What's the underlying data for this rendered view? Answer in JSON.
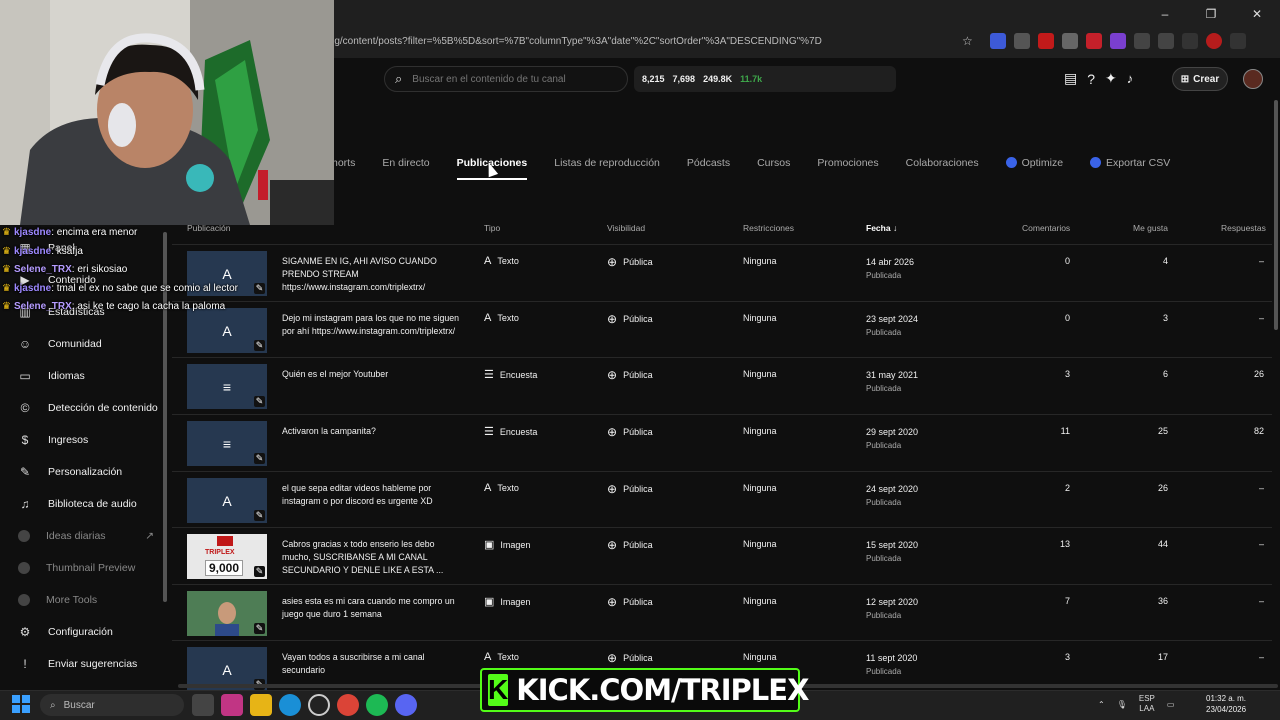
{
  "browser": {
    "url": "Mg/content/posts?filter=%5B%5D&sort=%7B\"columnType\"%3A\"date\"%2C\"sortOrder\"%3A\"DESCENDING\"%7D"
  },
  "header": {
    "search_placeholder": "Buscar en el contenido de tu canal",
    "stats": {
      "a": "8,215",
      "b": "7,698",
      "c": "249.8K",
      "d": "11.7k"
    },
    "create_label": "Crear"
  },
  "tabs": [
    {
      "label": "horts"
    },
    {
      "label": "En directo"
    },
    {
      "label": "Publicaciones"
    },
    {
      "label": "Listas de reproducción"
    },
    {
      "label": "Pódcasts"
    },
    {
      "label": "Cursos"
    },
    {
      "label": "Promociones"
    },
    {
      "label": "Colaboraciones"
    },
    {
      "label": "Optimize"
    },
    {
      "label": "Exportar CSV"
    }
  ],
  "sidebar": {
    "items": [
      {
        "label": "Panel"
      },
      {
        "label": "Contenido"
      },
      {
        "label": "Estadísticas"
      },
      {
        "label": "Comunidad"
      },
      {
        "label": "Idiomas"
      },
      {
        "label": "Detección de contenido"
      },
      {
        "label": "Ingresos"
      },
      {
        "label": "Personalización"
      },
      {
        "label": "Biblioteca de audio"
      },
      {
        "label": "Ideas diarias"
      },
      {
        "label": "Thumbnail Preview"
      },
      {
        "label": "More Tools"
      },
      {
        "label": "Configuración"
      },
      {
        "label": "Enviar sugerencias"
      }
    ]
  },
  "table": {
    "headers": {
      "post": "Publicación",
      "type": "Tipo",
      "visibility": "Visibilidad",
      "restrictions": "Restricciones",
      "date": "Fecha",
      "comments": "Comentarios",
      "likes": "Me gusta",
      "replies": "Respuestas"
    },
    "rows": [
      {
        "thumb": "A",
        "text": "SIGANME EN IG, AHI AVISO CUANDO PRENDO STREAM https://www.instagram.com/triplextrx/",
        "type": "Texto",
        "visibility": "Pública",
        "restrictions": "Ninguna",
        "date": "14 abr 2026",
        "status": "Publicada",
        "comments": "0",
        "likes": "4",
        "replies": "–"
      },
      {
        "thumb": "A",
        "text": "Dejo mi instagram para los que no me siguen por ahí https://www.instagram.com/triplextrx/",
        "type": "Texto",
        "visibility": "Pública",
        "restrictions": "Ninguna",
        "date": "23 sept 2024",
        "status": "Publicada",
        "comments": "0",
        "likes": "3",
        "replies": "–"
      },
      {
        "thumb": "≡",
        "text": "Quién es el mejor Youtuber",
        "type": "Encuesta",
        "visibility": "Pública",
        "restrictions": "Ninguna",
        "date": "31 may 2021",
        "status": "Publicada",
        "comments": "3",
        "likes": "6",
        "replies": "26"
      },
      {
        "thumb": "≡",
        "text": "Activaron la campanita?",
        "type": "Encuesta",
        "visibility": "Pública",
        "restrictions": "Ninguna",
        "date": "29 sept 2020",
        "status": "Publicada",
        "comments": "11",
        "likes": "25",
        "replies": "82"
      },
      {
        "thumb": "A",
        "text": "el que sepa editar videos hableme por instagram o por discord es urgente XD",
        "type": "Texto",
        "visibility": "Pública",
        "restrictions": "Ninguna",
        "date": "24 sept 2020",
        "status": "Publicada",
        "comments": "2",
        "likes": "26",
        "replies": "–"
      },
      {
        "thumb": "9,000",
        "text": "Cabros gracias x todo enserio les debo mucho, SUSCRIBANSE A MI CANAL SECUNDARIO Y DENLE LIKE A ESTA ...",
        "type": "Imagen",
        "visibility": "Pública",
        "restrictions": "Ninguna",
        "date": "15 sept 2020",
        "status": "Publicada",
        "comments": "13",
        "likes": "44",
        "replies": "–"
      },
      {
        "thumb": "",
        "text": "asies esta es mi cara cuando me compro un juego que duro 1 semana",
        "type": "Imagen",
        "visibility": "Pública",
        "restrictions": "Ninguna",
        "date": "12 sept 2020",
        "status": "Publicada",
        "comments": "7",
        "likes": "36",
        "replies": "–"
      },
      {
        "thumb": "A",
        "text": "Vayan todos a suscribirse a mi canal secundario",
        "type": "Texto",
        "visibility": "Pública",
        "restrictions": "Ninguna",
        "date": "11 sept 2020",
        "status": "Publicada",
        "comments": "3",
        "likes": "17",
        "replies": "–"
      }
    ]
  },
  "chat": [
    {
      "user": "kjasdne",
      "msg": "encima era menor"
    },
    {
      "user": "kjasdne",
      "msg": "ksafja"
    },
    {
      "user": "Selene_TRX",
      "msg": "eri sikosiao"
    },
    {
      "user": "kjasdne",
      "msg": "tmal el ex no sabe que se comio al lector"
    },
    {
      "user": "Selene_TRX",
      "msg": "asi ke te cago la cacha la paloma"
    }
  ],
  "taskbar": {
    "search": "Buscar",
    "lang": "ESP",
    "lang2": "LAA",
    "time": "01:32 a. m.",
    "date": "23/04/2026"
  },
  "overlay": {
    "kick": "KICK.COM/TRIPLEX"
  },
  "thumb_brand": "TRIPLEX"
}
